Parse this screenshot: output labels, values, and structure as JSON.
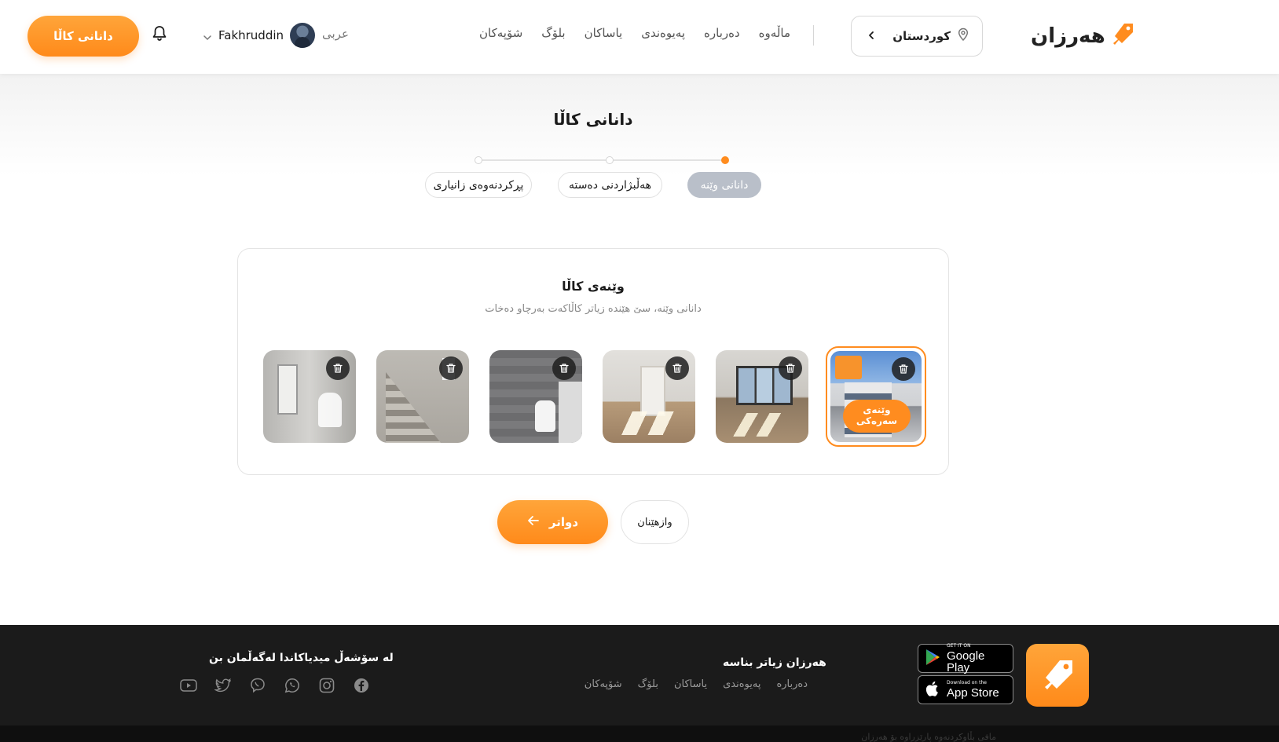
{
  "header": {
    "add_button": "دانانی کاڵا",
    "user_name": "Fakhruddin",
    "language": "عربی",
    "nav": [
      "ماڵەوە",
      "دەربارە",
      "پەیوەندی",
      "یاساکان",
      "بلۆگ",
      "شۆپەکان"
    ],
    "region": "کوردستان",
    "logo_text": "هەرزان"
  },
  "page": {
    "title": "دانانی کاڵا",
    "steps": [
      {
        "label": "دانانی وێنە",
        "active": true
      },
      {
        "label": "هەڵبژاردنی دەستە",
        "active": false
      },
      {
        "label": "پڕکردنەوەی زانیاری",
        "active": false
      }
    ]
  },
  "images_card": {
    "title": "وێنەی کاڵا",
    "subtitle": "دانانی وێنە، سێ هێندە زیاتر کاڵاکەت بەرچاو دەخات",
    "cover_label": "وێنەی سەرەکی",
    "images": [
      "house-facade",
      "room-window",
      "empty-room",
      "bathroom-toilet",
      "staircase",
      "shower-room"
    ]
  },
  "actions": {
    "next_label": "دواتر",
    "cancel_label": "وازهێنان"
  },
  "footer": {
    "title": "هەرزان زیاتر بناسە",
    "links": [
      "دەربارە",
      "پەیوەندی",
      "یاساکان",
      "بلۆگ",
      "شۆپەکان"
    ],
    "social_title": "لە سۆشەڵ میدیاکاندا لەگەڵمان بن",
    "google_play_small": "GET IT ON",
    "google_play_big": "Google Play",
    "app_store_small": "Download on the",
    "app_store_big": "App Store",
    "bottom_text": "مافی بڵاوکردنەوە پارێزراوە بۆ هەرزان"
  },
  "colors": {
    "accent": "#ff8c1f",
    "footer_bg": "#1b1b1b",
    "active_step": "#b9bfc9"
  }
}
